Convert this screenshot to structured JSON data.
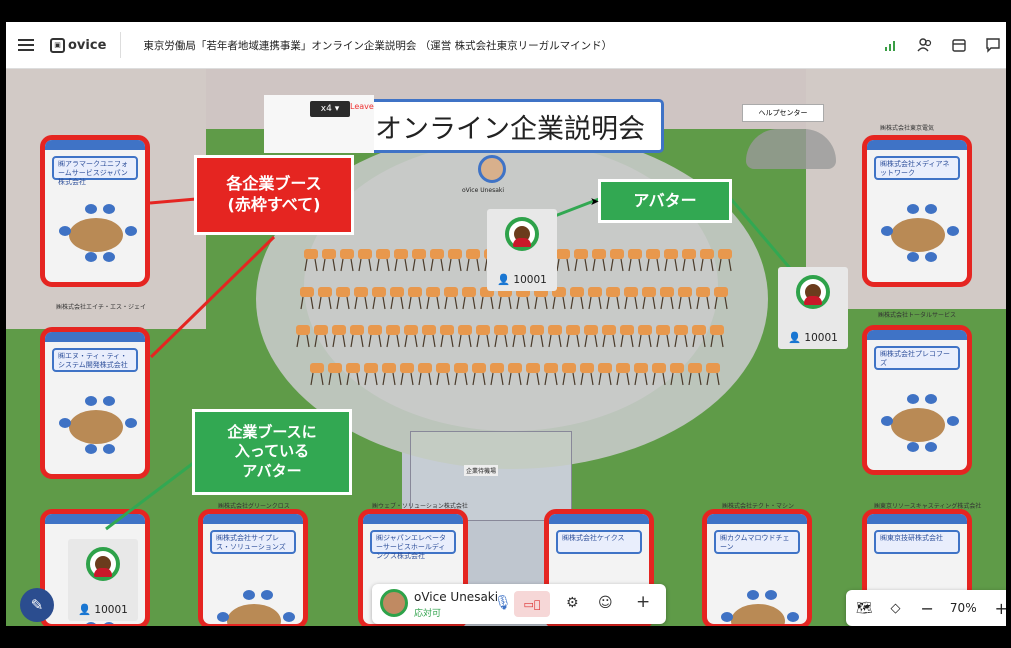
{
  "app": {
    "logo_text": "ovice",
    "space_title": "東京労働局「若年者地域連携事業」オンライン企業説明会 （運営 株式会社東京リーガルマインド）"
  },
  "top_icons": [
    "signal-icon",
    "people-icon",
    "calendar-icon",
    "chat-icon"
  ],
  "map": {
    "main_sign": "オンライン企業説明会",
    "speed_label": "x4",
    "leave_label": "Leave",
    "help_center": "ヘルプセンター",
    "reception_label": "企業待機場",
    "presenter_name": "oVice Unesaki"
  },
  "booths": [
    {
      "id": "l1",
      "sign": "㈱アラマークユニフォームサービスジャパン株式会社",
      "caption": "㈱株式会社エイチ・エス・ジェイ"
    },
    {
      "id": "l2",
      "sign": "㈱エヌ・ティ・ティ・システム開発株式会社",
      "caption": ""
    },
    {
      "id": "r1",
      "sign": "㈱株式会社メディアネットワーク",
      "caption": "㈱株式会社東京電気"
    },
    {
      "id": "r2",
      "sign": "㈱株式会社プレコフーズ",
      "caption": "㈱株式会社トータルサービス"
    },
    {
      "id": "b1",
      "sign": "",
      "caption": ""
    },
    {
      "id": "b2",
      "sign": "㈱株式会社サイプレス・ソリューションズ",
      "caption": "㈱株式会社グリーンクロス"
    },
    {
      "id": "b3",
      "sign": "㈱ジャパンエレベーターサービスホールディングス株式会社",
      "caption": "㈱ウェブ・ソリューション株式会社"
    },
    {
      "id": "b4",
      "sign": "㈱株式会社ケイクス",
      "caption": ""
    },
    {
      "id": "b5",
      "sign": "㈱カクムマロウドチェーン",
      "caption": "㈱株式会社テクト・マシン"
    },
    {
      "id": "b6",
      "sign": "㈱東京技研株式会社",
      "caption": "㈱東京リソースキャスティング株式会社"
    }
  ],
  "callouts": {
    "booths": "各企業ブース\n(赤枠すべて)",
    "avatar": "アバター",
    "in_booth": "企業ブースに\n入っている\nアバター"
  },
  "avatars": [
    {
      "id": "a1",
      "user_id": "10001"
    },
    {
      "id": "a2",
      "user_id": "10001"
    },
    {
      "id": "a3",
      "user_id": "10001"
    }
  ],
  "bottom_bar": {
    "user_name": "oVice Unesaki",
    "status": "応対可"
  },
  "zoom": {
    "value": "70%",
    "minus": "−",
    "plus": "+"
  },
  "colors": {
    "booth_border": "#e52521",
    "callout_red": "#e52521",
    "callout_green": "#32a852",
    "accent_blue": "#3f73c6"
  }
}
